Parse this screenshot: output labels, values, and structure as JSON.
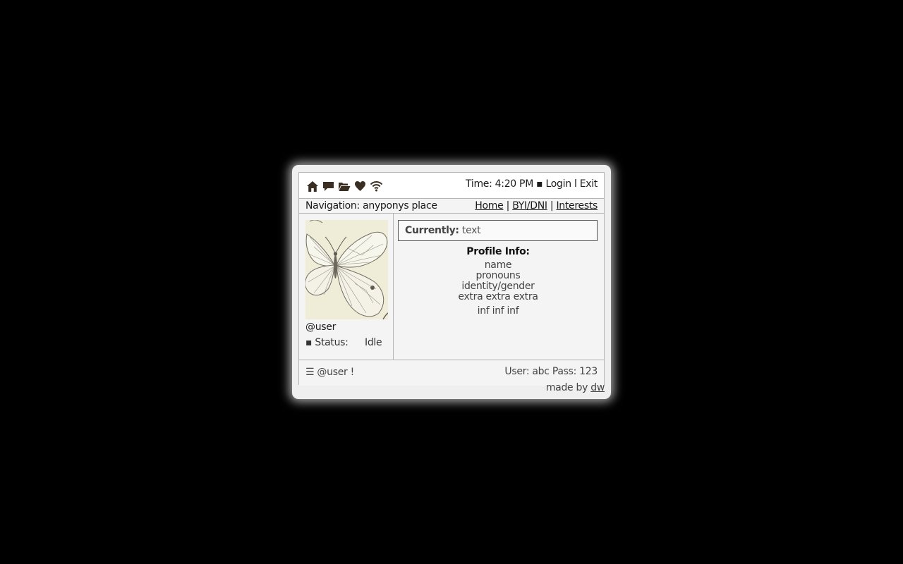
{
  "toolbar": {
    "icons": [
      "home-icon",
      "chat-icon",
      "folder-icon",
      "heart-icon",
      "wifi-icon"
    ],
    "time_label": "Time:",
    "time_value": "4:20 PM",
    "separator": "▪",
    "login": "Login",
    "divider": "l",
    "exit": "Exit"
  },
  "nav": {
    "label": "Navigation:",
    "place": "anyponys place",
    "links": [
      "Home",
      "BYI/DNI",
      "Interests"
    ],
    "link_sep": "|"
  },
  "sidebar": {
    "username": "@user",
    "status_bullet": "▪",
    "status_label": "Status:",
    "status_value": "Idle"
  },
  "main": {
    "currently_label": "Currently:",
    "currently_value": "text",
    "profile_title": "Profile Info:",
    "profile_lines": [
      "name",
      "pronouns",
      "identity/gender",
      "extra extra extra"
    ],
    "profile_extra": "inf inf inf"
  },
  "footer": {
    "menu_glyph": "☰",
    "greeting": "@user !",
    "credentials": "User: abc Pass: 123"
  },
  "credit": {
    "text": "made by",
    "link": "dw"
  },
  "colors": {
    "background": "#000000",
    "panel": "#f4f4f4",
    "border": "#b5b5b5",
    "icon": "#3a2e22"
  }
}
